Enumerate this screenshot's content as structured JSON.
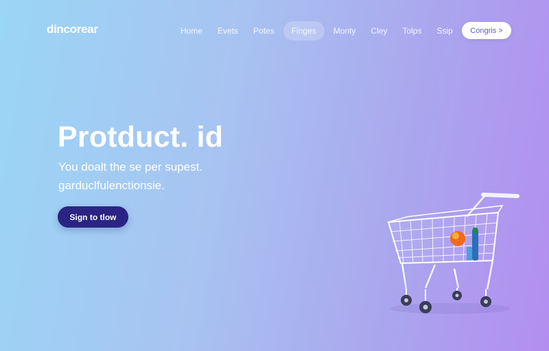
{
  "brand": {
    "logo_text": "dincorear"
  },
  "nav": {
    "items": [
      {
        "label": "Home",
        "active": false
      },
      {
        "label": "Evets",
        "active": false
      },
      {
        "label": "Potes",
        "active": false
      },
      {
        "label": "Finges",
        "active": true
      },
      {
        "label": "Monty",
        "active": false
      },
      {
        "label": "Cley",
        "active": false
      },
      {
        "label": "Tolps",
        "active": false
      },
      {
        "label": "Ssip",
        "active": false
      }
    ],
    "cta_label": "Congris >"
  },
  "hero": {
    "title": "Protduct. id",
    "subtitle_line1": "You doalt the se per supest.",
    "subtitle_line2": "garduclfulenctionsie.",
    "button_label": "Sign to tlow"
  },
  "colors": {
    "primary_button": "#2b2484",
    "gradient_start": "#9ad6f6",
    "gradient_end": "#b38ef0",
    "cta_text": "#5b5ea8"
  },
  "illustration": {
    "icon": "shopping-cart-icon"
  }
}
